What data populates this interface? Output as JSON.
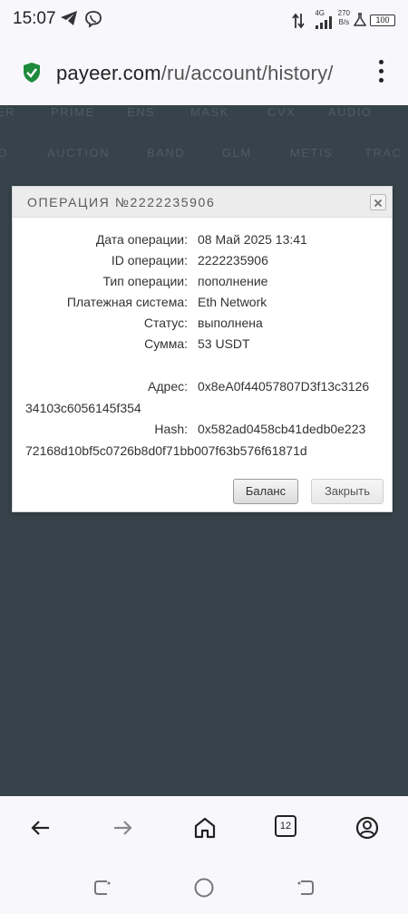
{
  "status_bar": {
    "time": "15:07",
    "network": "4G",
    "speed_value": "270",
    "speed_unit": "B/s",
    "battery": "100"
  },
  "browser": {
    "url_domain": "payeer.com",
    "url_path": "/ru/account/history/"
  },
  "background_tickers": {
    "row1": [
      "ER",
      "PRIME",
      "ENS",
      "MASK",
      "CVX",
      "AUDIO"
    ],
    "row2": [
      "D",
      "AUCTION",
      "BAND",
      "GLM",
      "METIS",
      "TRAC"
    ]
  },
  "modal": {
    "title": "ОПЕРАЦИЯ №2222235906",
    "fields": [
      {
        "label": "Дата операции:",
        "value": "08 Май 2025 13:41"
      },
      {
        "label": "ID операции:",
        "value": "2222235906"
      },
      {
        "label": "Тип операции:",
        "value": "пополнение"
      },
      {
        "label": "Платежная система:",
        "value": "Eth Network"
      },
      {
        "label": "Статус:",
        "value": "выполнена"
      },
      {
        "label": "Сумма:",
        "value": "53 USDT"
      }
    ],
    "address_label": "Адрес:",
    "address_line1": "0x8eA0f44057807D3f13c3126",
    "address_line2": "34103c6056145f354",
    "hash_label": "Hash:",
    "hash_line1": "0x582ad0458cb41dedb0e223",
    "hash_line2": "72168d10bf5c0726b8d0f71bb007f63b576f61871d",
    "balance_button": "Баланс",
    "close_button": "Закрыть"
  },
  "bottom_nav": {
    "tab_count": "12"
  },
  "colors": {
    "page_bg": "#37434a",
    "shield_green": "#1e8a3c"
  }
}
